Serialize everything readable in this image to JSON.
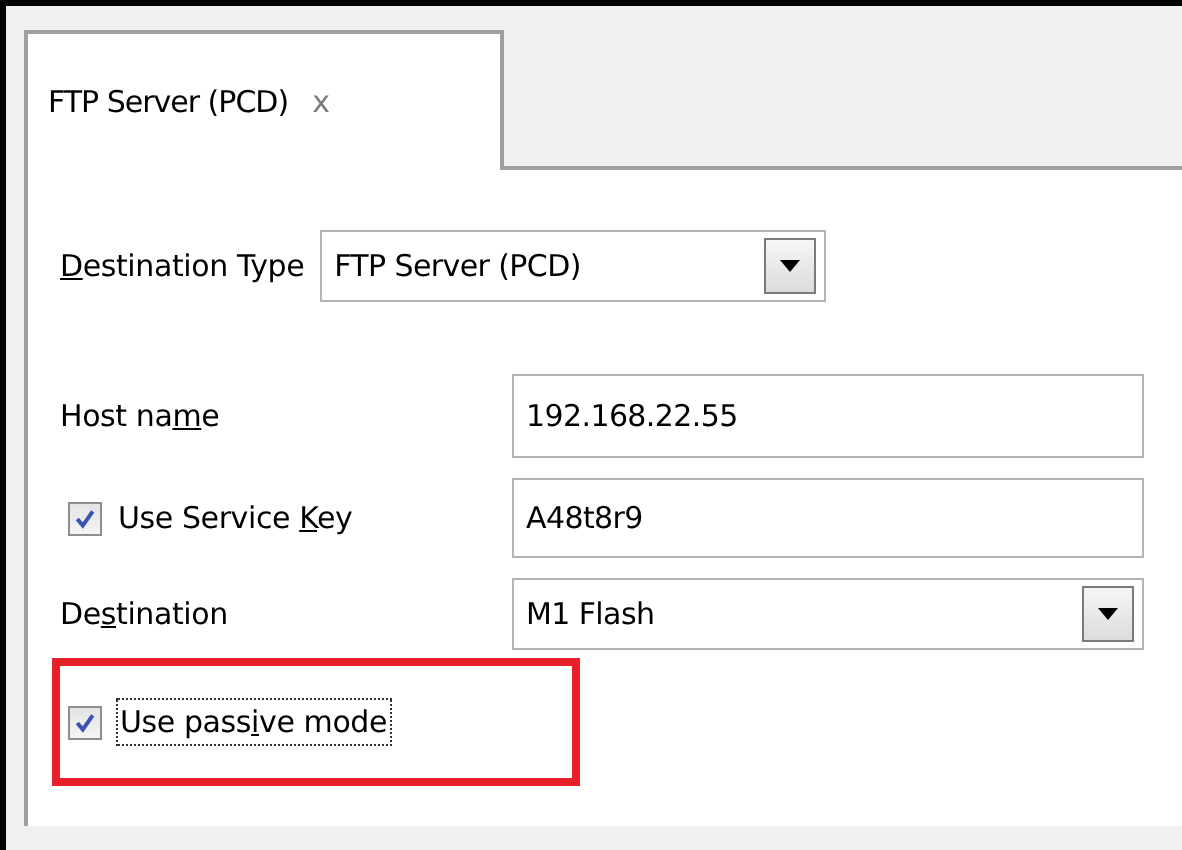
{
  "tabs": [
    {
      "label": "FTP Server (PCD)",
      "close": "x",
      "selected": true
    }
  ],
  "destination_type": {
    "label_parts": {
      "key": "D",
      "after": "estination Type"
    },
    "value": "FTP Server (PCD)"
  },
  "host_name": {
    "label_parts": {
      "before": "Host na",
      "key": "m",
      "after": "e"
    },
    "value": "192.168.22.55"
  },
  "service_key": {
    "label_parts": {
      "before": "Use Service ",
      "key": "K",
      "after": "ey"
    },
    "checked": true,
    "value": "A48t8r9"
  },
  "destination": {
    "label_parts": {
      "before": "De",
      "key": "s",
      "after": "tination"
    },
    "value": "M1 Flash"
  },
  "passive_mode": {
    "label_parts": {
      "before": "Use pass",
      "key": "i",
      "after": "ve mode"
    },
    "checked": true,
    "focused": true,
    "highlighted": true
  }
}
